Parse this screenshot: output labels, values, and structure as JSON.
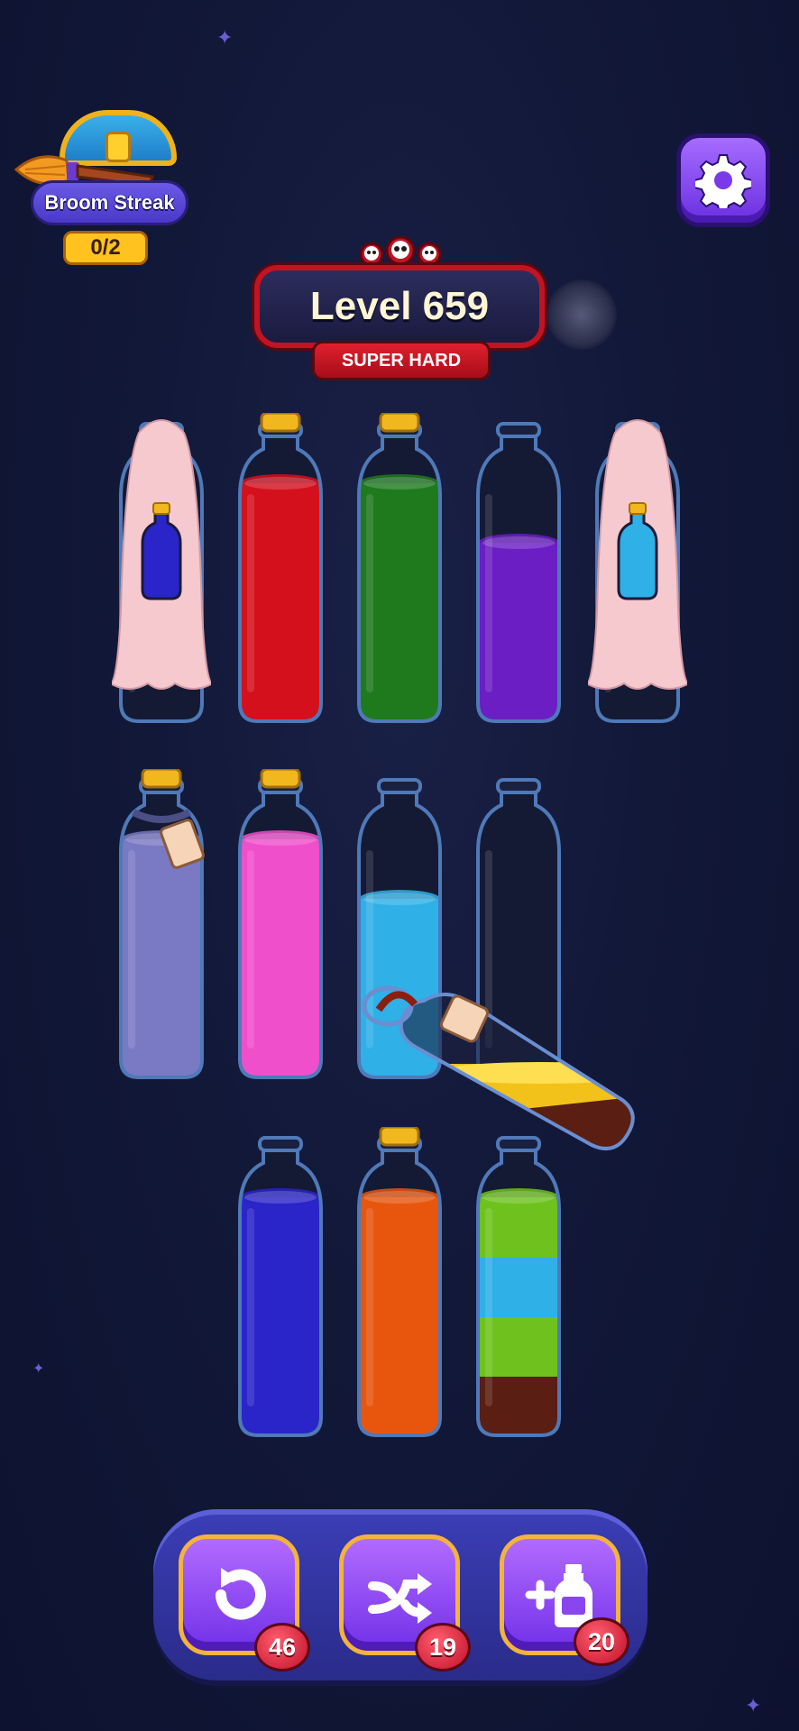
{
  "streak": {
    "label": "Broom Streak",
    "count": "0/2"
  },
  "level": {
    "title": "Level 659",
    "difficulty": "SUPER HARD"
  },
  "powerups": [
    {
      "name": "undo",
      "icon": "undo-arrow-icon",
      "count": "46"
    },
    {
      "name": "shuffle",
      "icon": "shuffle-arrows-icon",
      "count": "19"
    },
    {
      "name": "add-bottle",
      "icon": "plus-bottle-icon",
      "count": "20"
    }
  ],
  "colors": {
    "red": "#d4101c",
    "green": "#1f7a1e",
    "purple": "#6a1ec4",
    "lavender": "#7a79c4",
    "pink": "#f04fcb",
    "cyan": "#2fb0e6",
    "blue": "#2a25c8",
    "orange": "#e8560e",
    "lime": "#6fc21e",
    "brown": "#5a1e12",
    "yellow": "#f2c21a"
  },
  "bottles": [
    {
      "id": "r1b1",
      "state": "covered",
      "hint_color": "blue"
    },
    {
      "id": "r1b2",
      "state": "corked",
      "layers": [
        "red",
        "red",
        "red",
        "red"
      ]
    },
    {
      "id": "r1b3",
      "state": "corked",
      "layers": [
        "green",
        "green",
        "green",
        "green"
      ]
    },
    {
      "id": "r1b4",
      "state": "open",
      "layers": [
        "purple",
        "purple",
        "purple"
      ]
    },
    {
      "id": "r1b5",
      "state": "covered",
      "hint_color": "cyan"
    },
    {
      "id": "r2b1",
      "state": "corked-tied",
      "layers": [
        "lavender",
        "lavender",
        "lavender",
        "lavender"
      ]
    },
    {
      "id": "r2b2",
      "state": "corked",
      "layers": [
        "pink",
        "pink",
        "pink",
        "pink"
      ]
    },
    {
      "id": "r2b3",
      "state": "open",
      "layers": [
        "cyan",
        "cyan",
        "cyan"
      ]
    },
    {
      "id": "r2b4",
      "state": "open",
      "layers": []
    },
    {
      "id": "r3b1",
      "state": "open",
      "layers": [
        "blue",
        "blue",
        "blue",
        "blue"
      ]
    },
    {
      "id": "r3b2",
      "state": "corked",
      "layers": [
        "orange",
        "orange",
        "orange",
        "orange"
      ]
    },
    {
      "id": "r3b3",
      "state": "open",
      "layers": [
        "brown",
        "lime",
        "cyan",
        "lime"
      ]
    }
  ],
  "pouring_bottle": {
    "state": "tied",
    "layers": [
      "brown",
      "yellow"
    ]
  }
}
